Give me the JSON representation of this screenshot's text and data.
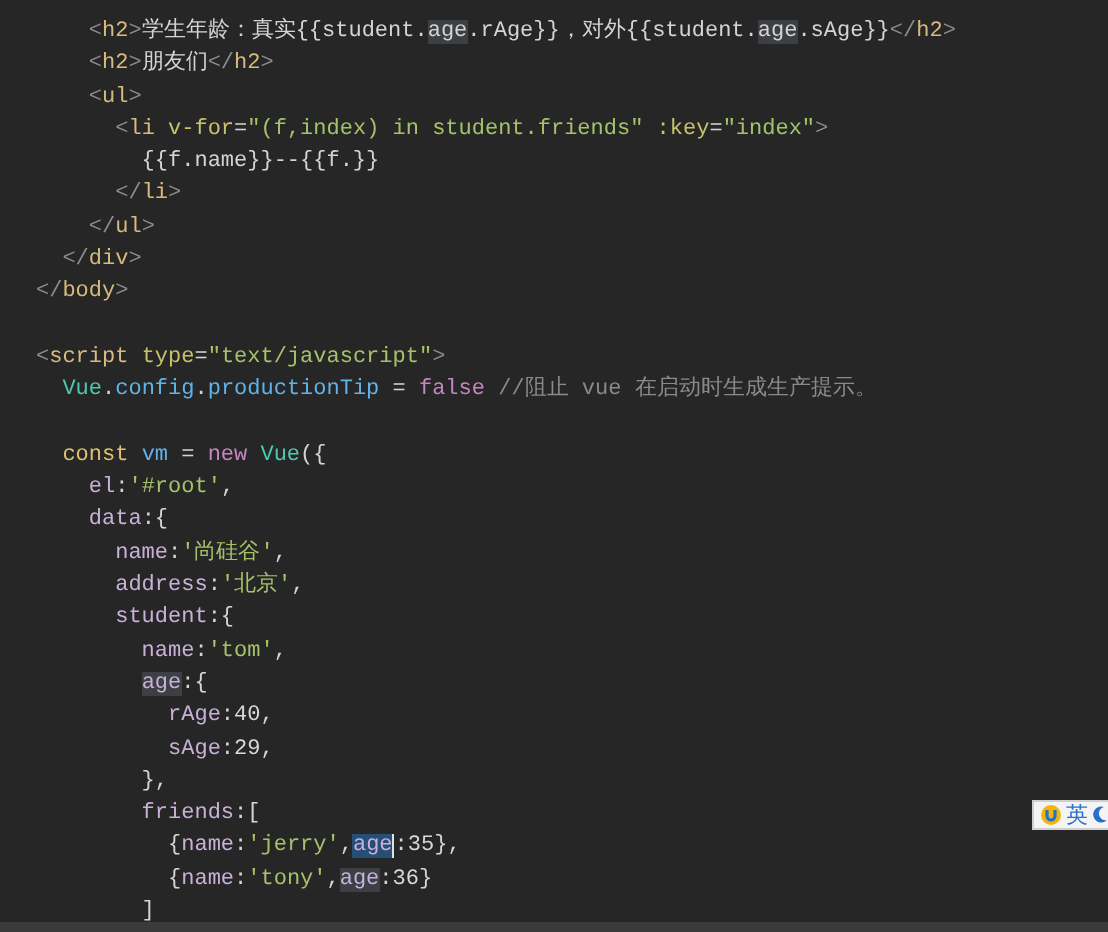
{
  "editor": {
    "lines": [
      {
        "kind": "code",
        "tokens": [
          {
            "kind": "punct",
            "text": "    <"
          },
          {
            "kind": "tag",
            "text": "h2"
          },
          {
            "kind": "punct",
            "text": ">"
          },
          {
            "kind": "text",
            "text": "学生年龄：真实{{student."
          },
          {
            "kind": "text",
            "text": "age",
            "highlighted": true
          },
          {
            "kind": "text",
            "text": ".rAge}}，对外{{student."
          },
          {
            "kind": "text",
            "text": "age",
            "highlighted": true
          },
          {
            "kind": "text",
            "text": ".sAge}}"
          },
          {
            "kind": "punct",
            "text": "</"
          },
          {
            "kind": "tag",
            "text": "h2"
          },
          {
            "kind": "punct",
            "text": ">"
          }
        ]
      },
      {
        "kind": "code",
        "tokens": [
          {
            "kind": "punct",
            "text": "    <"
          },
          {
            "kind": "tag",
            "text": "h2"
          },
          {
            "kind": "punct",
            "text": ">"
          },
          {
            "kind": "text",
            "text": "朋友们"
          },
          {
            "kind": "punct",
            "text": "</"
          },
          {
            "kind": "tag",
            "text": "h2"
          },
          {
            "kind": "punct",
            "text": ">"
          }
        ]
      },
      {
        "kind": "code",
        "tokens": [
          {
            "kind": "punct",
            "text": "    <"
          },
          {
            "kind": "tag",
            "text": "ul"
          },
          {
            "kind": "punct",
            "text": ">"
          }
        ]
      },
      {
        "kind": "code",
        "tokens": [
          {
            "kind": "punct",
            "text": "      <"
          },
          {
            "kind": "tag",
            "text": "li "
          },
          {
            "kind": "attr",
            "text": "v-for"
          },
          {
            "kind": "text",
            "text": "="
          },
          {
            "kind": "string",
            "text": "\"(f,index) in student.friends\" "
          },
          {
            "kind": "attr",
            "text": ":key"
          },
          {
            "kind": "text",
            "text": "="
          },
          {
            "kind": "string",
            "text": "\"index\""
          },
          {
            "kind": "punct",
            "text": ">"
          }
        ]
      },
      {
        "kind": "code",
        "tokens": [
          {
            "kind": "text",
            "text": "        {{f.name}}--{{f.}}"
          }
        ]
      },
      {
        "kind": "code",
        "tokens": [
          {
            "kind": "punct",
            "text": "      </"
          },
          {
            "kind": "tag",
            "text": "li"
          },
          {
            "kind": "punct",
            "text": ">"
          }
        ]
      },
      {
        "kind": "code",
        "tokens": [
          {
            "kind": "punct",
            "text": "    </"
          },
          {
            "kind": "tag",
            "text": "ul"
          },
          {
            "kind": "punct",
            "text": ">"
          }
        ]
      },
      {
        "kind": "code",
        "tokens": [
          {
            "kind": "punct",
            "text": "  </"
          },
          {
            "kind": "tag",
            "text": "div"
          },
          {
            "kind": "punct",
            "text": ">"
          }
        ]
      },
      {
        "kind": "code",
        "tokens": [
          {
            "kind": "punct",
            "text": "</"
          },
          {
            "kind": "tag",
            "text": "body"
          },
          {
            "kind": "punct",
            "text": ">"
          }
        ]
      },
      {
        "kind": "blank"
      },
      {
        "kind": "code",
        "tokens": [
          {
            "kind": "punct",
            "text": "<"
          },
          {
            "kind": "tag",
            "text": "script "
          },
          {
            "kind": "attr",
            "text": "type"
          },
          {
            "kind": "text",
            "text": "="
          },
          {
            "kind": "string",
            "text": "\"text/javascript\""
          },
          {
            "kind": "punct",
            "text": ">"
          }
        ]
      },
      {
        "kind": "code",
        "tokens": [
          {
            "kind": "class",
            "text": "  Vue"
          },
          {
            "kind": "text",
            "text": "."
          },
          {
            "kind": "prop",
            "text": "config"
          },
          {
            "kind": "text",
            "text": "."
          },
          {
            "kind": "prop",
            "text": "productionTip"
          },
          {
            "kind": "text",
            "text": " = "
          },
          {
            "kind": "keyword",
            "text": "false "
          },
          {
            "kind": "comment",
            "text": "//阻止 vue 在启动时生成生产提示。"
          }
        ]
      },
      {
        "kind": "blank"
      },
      {
        "kind": "code",
        "tokens": [
          {
            "kind": "storage",
            "text": "  const "
          },
          {
            "kind": "var",
            "text": "vm"
          },
          {
            "kind": "text",
            "text": " = "
          },
          {
            "kind": "keyword",
            "text": "new "
          },
          {
            "kind": "class",
            "text": "Vue"
          },
          {
            "kind": "text",
            "text": "({"
          }
        ]
      },
      {
        "kind": "code",
        "tokens": [
          {
            "kind": "key",
            "text": "    el"
          },
          {
            "kind": "text",
            "text": ":"
          },
          {
            "kind": "string",
            "text": "'#root'"
          },
          {
            "kind": "text",
            "text": ","
          }
        ]
      },
      {
        "kind": "code",
        "tokens": [
          {
            "kind": "key",
            "text": "    data"
          },
          {
            "kind": "text",
            "text": ":{"
          }
        ]
      },
      {
        "kind": "code",
        "tokens": [
          {
            "kind": "key",
            "text": "      name"
          },
          {
            "kind": "text",
            "text": ":"
          },
          {
            "kind": "string",
            "text": "'尚硅谷'"
          },
          {
            "kind": "text",
            "text": ","
          }
        ]
      },
      {
        "kind": "code",
        "tokens": [
          {
            "kind": "key",
            "text": "      address"
          },
          {
            "kind": "text",
            "text": ":"
          },
          {
            "kind": "string",
            "text": "'北京'"
          },
          {
            "kind": "text",
            "text": ","
          }
        ]
      },
      {
        "kind": "code",
        "tokens": [
          {
            "kind": "key",
            "text": "      student"
          },
          {
            "kind": "text",
            "text": ":{"
          }
        ]
      },
      {
        "kind": "code",
        "tokens": [
          {
            "kind": "key",
            "text": "        name"
          },
          {
            "kind": "text",
            "text": ":"
          },
          {
            "kind": "string",
            "text": "'tom'"
          },
          {
            "kind": "text",
            "text": ","
          }
        ]
      },
      {
        "kind": "code",
        "tokens": [
          {
            "kind": "key",
            "text": "        age",
            "highlighted": true
          },
          {
            "kind": "text",
            "text": ":{"
          }
        ]
      },
      {
        "kind": "code",
        "tokens": [
          {
            "kind": "key",
            "text": "          rAge"
          },
          {
            "kind": "text",
            "text": ":"
          },
          {
            "kind": "number",
            "text": "40"
          },
          {
            "kind": "text",
            "text": ","
          }
        ]
      },
      {
        "kind": "code",
        "tokens": [
          {
            "kind": "key",
            "text": "          sAge"
          },
          {
            "kind": "text",
            "text": ":"
          },
          {
            "kind": "number",
            "text": "29"
          },
          {
            "kind": "text",
            "text": ","
          }
        ]
      },
      {
        "kind": "code",
        "tokens": [
          {
            "kind": "text",
            "text": "        },"
          }
        ]
      },
      {
        "kind": "code",
        "tokens": [
          {
            "kind": "key",
            "text": "        friends"
          },
          {
            "kind": "text",
            "text": ":["
          }
        ]
      },
      {
        "kind": "code",
        "tokens": [
          {
            "kind": "text",
            "text": "          {"
          },
          {
            "kind": "key",
            "text": "name"
          },
          {
            "kind": "text",
            "text": ":"
          },
          {
            "kind": "string",
            "text": "'jerry'"
          },
          {
            "kind": "text",
            "text": ","
          },
          {
            "kind": "key",
            "text": "age",
            "selected": true
          },
          {
            "kind": "text",
            "text": ":"
          },
          {
            "kind": "number",
            "text": "35"
          },
          {
            "kind": "text",
            "text": "},"
          }
        ]
      },
      {
        "kind": "code",
        "tokens": [
          {
            "kind": "text",
            "text": "          {"
          },
          {
            "kind": "key",
            "text": "name"
          },
          {
            "kind": "text",
            "text": ":"
          },
          {
            "kind": "string",
            "text": "'tony'"
          },
          {
            "kind": "text",
            "text": ","
          },
          {
            "kind": "key",
            "text": "age",
            "highlighted": true
          },
          {
            "kind": "text",
            "text": ":"
          },
          {
            "kind": "number",
            "text": "36"
          },
          {
            "kind": "text",
            "text": "}"
          }
        ]
      },
      {
        "kind": "code",
        "tokens": [
          {
            "kind": "text",
            "text": "        ]"
          }
        ]
      }
    ]
  },
  "ime_indicator": {
    "mode": "英"
  }
}
